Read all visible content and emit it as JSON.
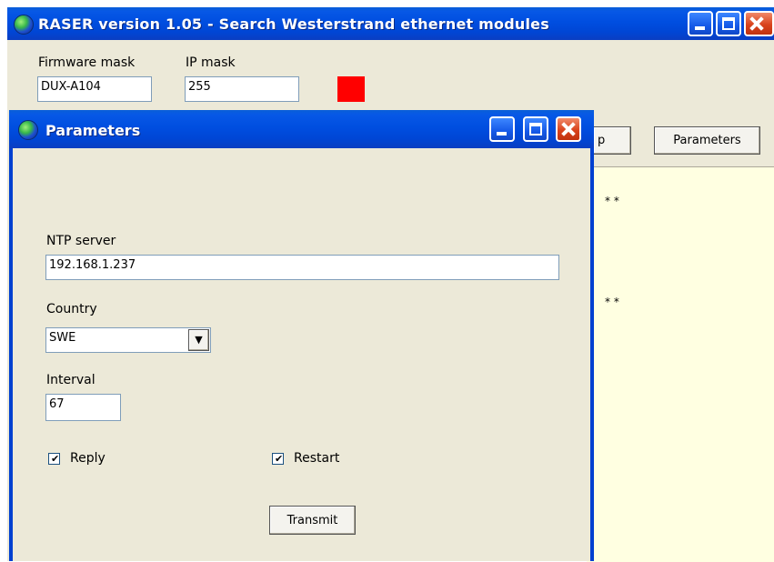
{
  "main": {
    "title": "RASER version 1.05 - Search Westerstrand ethernet modules",
    "firmware_mask_label": "Firmware mask",
    "firmware_mask_value": "DUX-A104",
    "ip_mask_label": "IP mask",
    "ip_mask_value": "255",
    "status_color": "#ff0000",
    "partial_button_label": "p",
    "parameters_button_label": "Parameters",
    "list_marker_1": "* *",
    "list_marker_2": "* *"
  },
  "dialog": {
    "title": "Parameters",
    "ntp_label": "NTP server",
    "ntp_value": "192.168.1.237",
    "country_label": "Country",
    "country_value": "SWE",
    "interval_label": "Interval",
    "interval_value": "67",
    "reply_label": "Reply",
    "reply_checked": true,
    "restart_label": "Restart",
    "restart_checked": true,
    "transmit_label": "Transmit"
  },
  "colors": {
    "titlebar": "#0046d5",
    "window_bg": "#ece9d8",
    "list_bg": "#ffffe1",
    "close_button": "#d9431d"
  }
}
